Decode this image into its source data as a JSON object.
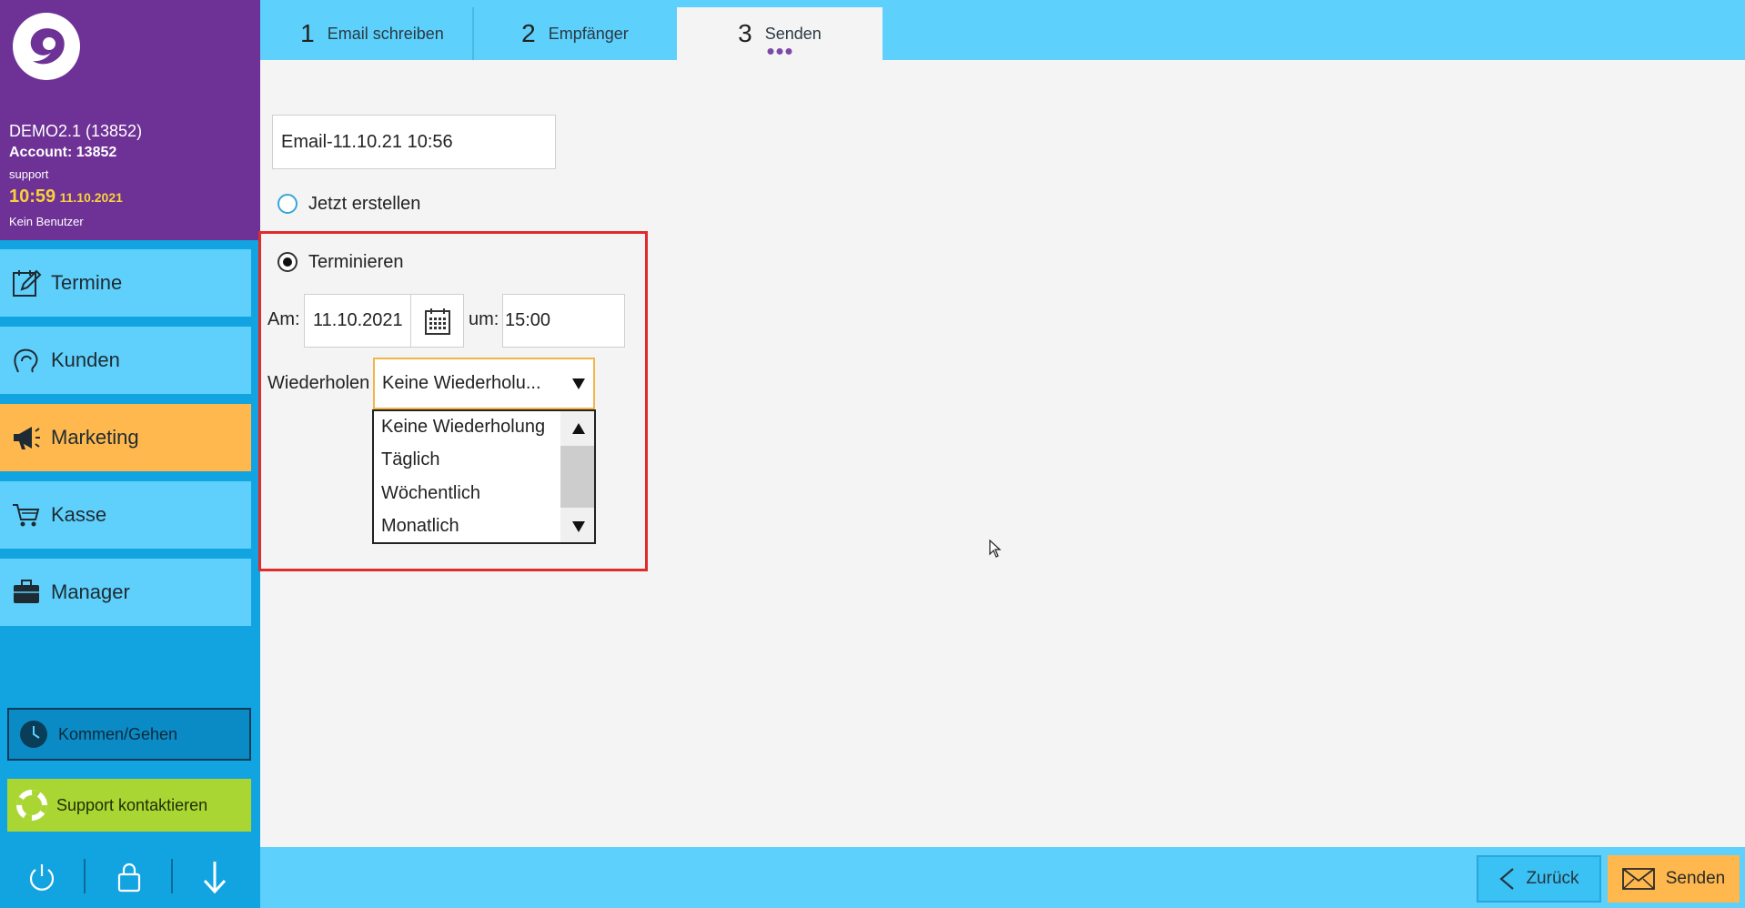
{
  "account": {
    "name": "DEMO2.1 (13852)",
    "account_line": "Account: 13852",
    "user_role": "support",
    "time": "10:59",
    "date": "11.10.2021",
    "user_status": "Kein Benutzer"
  },
  "nav": {
    "items": [
      {
        "label": "Termine",
        "icon": "calendar-edit-icon"
      },
      {
        "label": "Kunden",
        "icon": "customer-head-icon"
      },
      {
        "label": "Marketing",
        "icon": "megaphone-icon"
      },
      {
        "label": "Kasse",
        "icon": "shopping-cart-icon"
      },
      {
        "label": "Manager",
        "icon": "briefcase-icon"
      }
    ],
    "active": "Marketing"
  },
  "sidebar_buttons": {
    "clock": "Kommen/Gehen",
    "support": "Support kontaktieren"
  },
  "bottom_icons": [
    "power-icon",
    "lock-icon",
    "arrow-down-icon"
  ],
  "tabs": [
    {
      "num": "1",
      "label": "Email schreiben"
    },
    {
      "num": "2",
      "label": "Empfänger"
    },
    {
      "num": "3",
      "label": "Senden"
    }
  ],
  "active_tab": "3",
  "form": {
    "email_name": "Email-11.10.21 10:56",
    "option_now": "Jetzt erstellen",
    "option_schedule": "Terminieren",
    "selected_option": "Terminieren",
    "date_label": "Am:",
    "date_value": "11.10.2021",
    "time_label": "um:",
    "time_value": "15:00",
    "repeat_label": "Wiederholen",
    "repeat_value": "Keine Wiederholu...",
    "repeat_options": [
      "Keine Wiederholung",
      "Täglich",
      "Wöchentlich",
      "Monatlich"
    ]
  },
  "footer": {
    "back_label": "Zurück",
    "send_label": "Senden"
  },
  "colors": {
    "sidebar_header": "#6e3196",
    "sidebar": "#12a4e0",
    "nav_item": "#5fd0fb",
    "active": "#ffb84d",
    "support": "#a9d633",
    "highlight": "#e12b2b"
  }
}
